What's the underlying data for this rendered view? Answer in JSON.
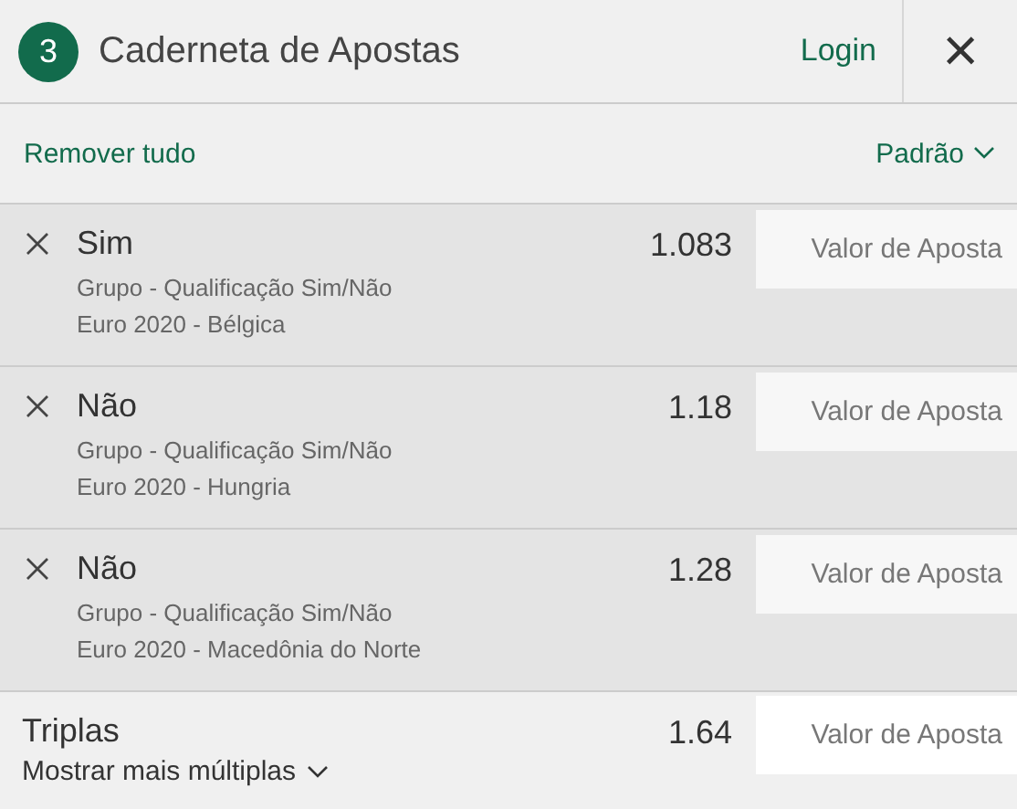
{
  "header": {
    "count": "3",
    "title": "Caderneta de Apostas",
    "login": "Login",
    "close": "×"
  },
  "toolbar": {
    "remove_all": "Remover tudo",
    "sort": "Padrão"
  },
  "bets": [
    {
      "selection": "Sim",
      "market": "Grupo - Qualificação Sim/Não",
      "event": "Euro 2020 - Bélgica",
      "odds": "1.083",
      "stake_placeholder": "Valor de Aposta"
    },
    {
      "selection": "Não",
      "market": "Grupo - Qualificação Sim/Não",
      "event": "Euro 2020 - Hungria",
      "odds": "1.18",
      "stake_placeholder": "Valor de Aposta"
    },
    {
      "selection": "Não",
      "market": "Grupo - Qualificação Sim/Não",
      "event": "Euro 2020 - Macedônia do Norte",
      "odds": "1.28",
      "stake_placeholder": "Valor de Aposta"
    }
  ],
  "multiple": {
    "name": "Triplas",
    "odds": "1.64",
    "stake_placeholder": "Valor de Aposta",
    "more": "Mostrar mais múltiplas"
  }
}
